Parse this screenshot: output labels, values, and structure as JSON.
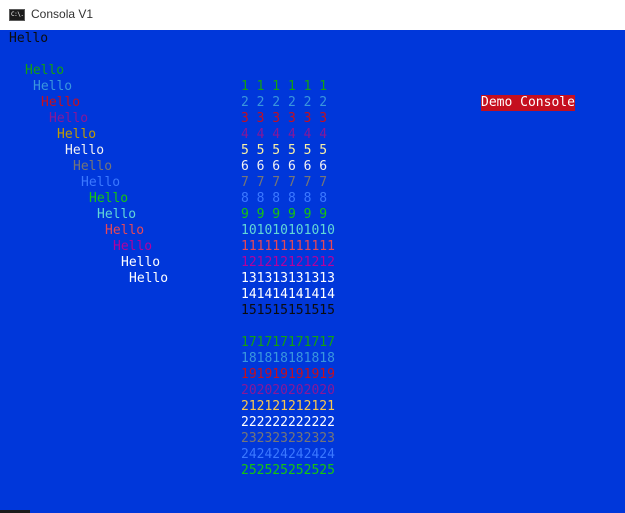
{
  "window": {
    "title": "Consola V1",
    "icon_name": "console-app-icon",
    "icon_glyph": "C:\\."
  },
  "console": {
    "background": "#0037da",
    "header_line": {
      "text": "Hello",
      "color": "#0c0c0c"
    },
    "hello_lines": [
      {
        "text": "Hello",
        "color": "#13a10e"
      },
      {
        "text": "Hello",
        "color": "#3a96dd"
      },
      {
        "text": "Hello",
        "color": "#c50f1f"
      },
      {
        "text": "Hello",
        "color": "#881798"
      },
      {
        "text": "Hello",
        "color": "#c19c00"
      },
      {
        "text": "Hello",
        "color": "#f2f2f2"
      },
      {
        "text": "Hello",
        "color": "#767676"
      },
      {
        "text": "Hello",
        "color": "#3b78ff"
      },
      {
        "text": "Hello",
        "color": "#16c60c"
      },
      {
        "text": "Hello",
        "color": "#61d6d6"
      },
      {
        "text": "Hello",
        "color": "#e74856"
      },
      {
        "text": "Hello",
        "color": "#b4009e"
      },
      {
        "text": "Hello",
        "color": "#ffffff"
      },
      {
        "text": "Hello",
        "color": "#ffffff"
      }
    ],
    "number_lines": [
      {
        "text": "1 1 1 1 1 1",
        "color": "#13a10e"
      },
      {
        "text": "2 2 2 2 2 2",
        "color": "#3a96dd"
      },
      {
        "text": "3 3 3 3 3 3",
        "color": "#c50f1f"
      },
      {
        "text": "4 4 4 4 4 4",
        "color": "#881798"
      },
      {
        "text": "5 5 5 5 5 5",
        "color": "#f9f1a5"
      },
      {
        "text": "6 6 6 6 6 6",
        "color": "#f2f2f2"
      },
      {
        "text": "7 7 7 7 7 7",
        "color": "#767676"
      },
      {
        "text": "8 8 8 8 8 8",
        "color": "#3b78ff"
      },
      {
        "text": "9 9 9 9 9 9",
        "color": "#16c60c"
      },
      {
        "text": "101010101010",
        "color": "#61d6d6"
      },
      {
        "text": "111111111111",
        "color": "#e74856"
      },
      {
        "text": "121212121212",
        "color": "#b4009e"
      },
      {
        "text": "131313131313",
        "color": "#ffffff"
      },
      {
        "text": "141414141414",
        "color": "#ffffff"
      },
      {
        "text": "151515151515",
        "color": "#0c0c0c"
      },
      {
        "text": "",
        "color": "#0037da"
      },
      {
        "text": "171717171717",
        "color": "#13a10e"
      },
      {
        "text": "181818181818",
        "color": "#3a96dd"
      },
      {
        "text": "191919191919",
        "color": "#c50f1f"
      },
      {
        "text": "202020202020",
        "color": "#881798"
      },
      {
        "text": "212121212121",
        "color": "#f9c74f"
      },
      {
        "text": "222222222222",
        "color": "#ffffff"
      },
      {
        "text": "232323232323",
        "color": "#767676"
      },
      {
        "text": "242424242424",
        "color": "#3b78ff"
      },
      {
        "text": "252525252525",
        "color": "#16c60c"
      }
    ],
    "badge": {
      "text": "Demo Console",
      "background": "#c50f1f",
      "color": "#ffffff"
    }
  }
}
